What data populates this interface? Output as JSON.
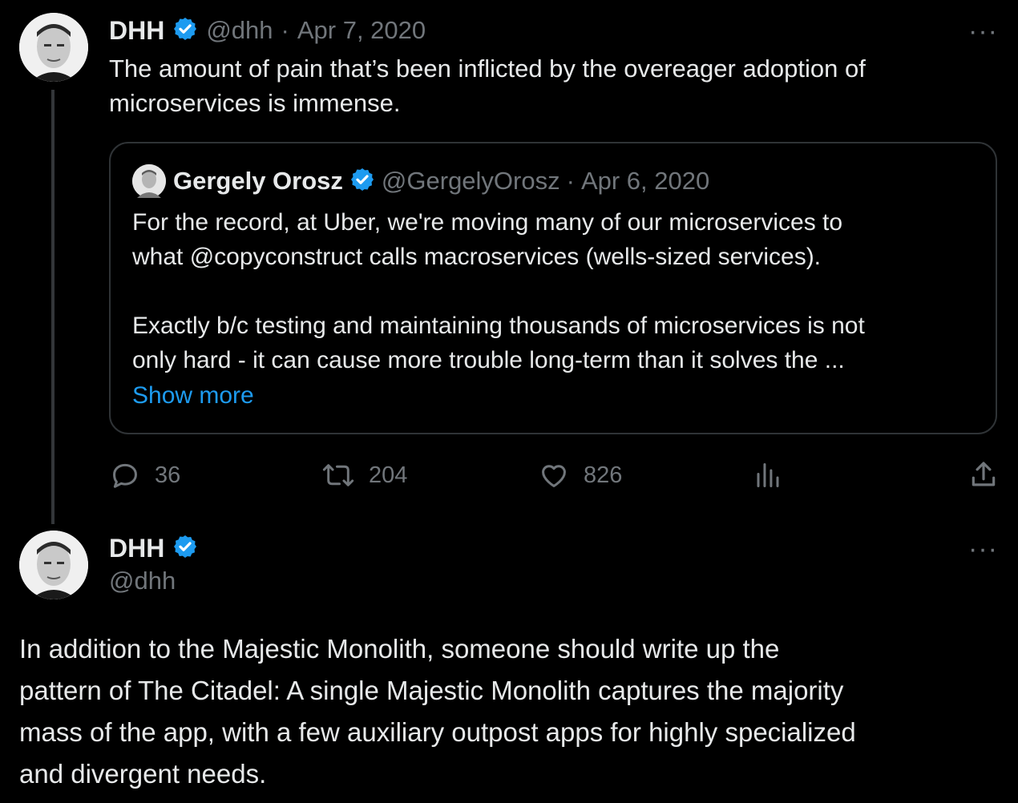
{
  "tweet1": {
    "name": "DHH",
    "handle": "@dhh",
    "separator": "·",
    "date": "Apr 7, 2020",
    "text": "The amount of pain that’s been inflicted by the overeager adoption of microservices is immense.",
    "more": "···"
  },
  "quote": {
    "name": "Gergely Orosz",
    "handle": "@GergelyOrosz",
    "separator": "·",
    "date": "Apr 6, 2020",
    "line1": "For the record, at Uber, we're moving many of our microservices to",
    "line2": "what @copyconstruct calls macroservices (wells-sized services).",
    "line3": "Exactly b/c testing and maintaining thousands of microservices is not",
    "line4": "only hard - it can cause more trouble long-term than it solves the ...",
    "show_more": "Show more"
  },
  "actions": {
    "replies": "36",
    "retweets": "204",
    "likes": "826"
  },
  "tweet2": {
    "name": "DHH",
    "handle": "@dhh",
    "more": "···",
    "line1": "In addition to the Majestic Monolith, someone should write up the",
    "line2": "pattern of The Citadel: A single Majestic Monolith captures the majority",
    "line3": "mass of the app, with a few auxiliary outpost apps for highly specialized",
    "line4": "and divergent needs."
  },
  "colors": {
    "background": "#000000",
    "text": "#e7e9ea",
    "muted": "#71767b",
    "accent": "#1d9bf0",
    "border": "#2f3336"
  },
  "icons": [
    "verified-badge-icon",
    "reply-icon",
    "retweet-icon",
    "like-icon",
    "analytics-icon",
    "share-icon",
    "more-icon"
  ]
}
